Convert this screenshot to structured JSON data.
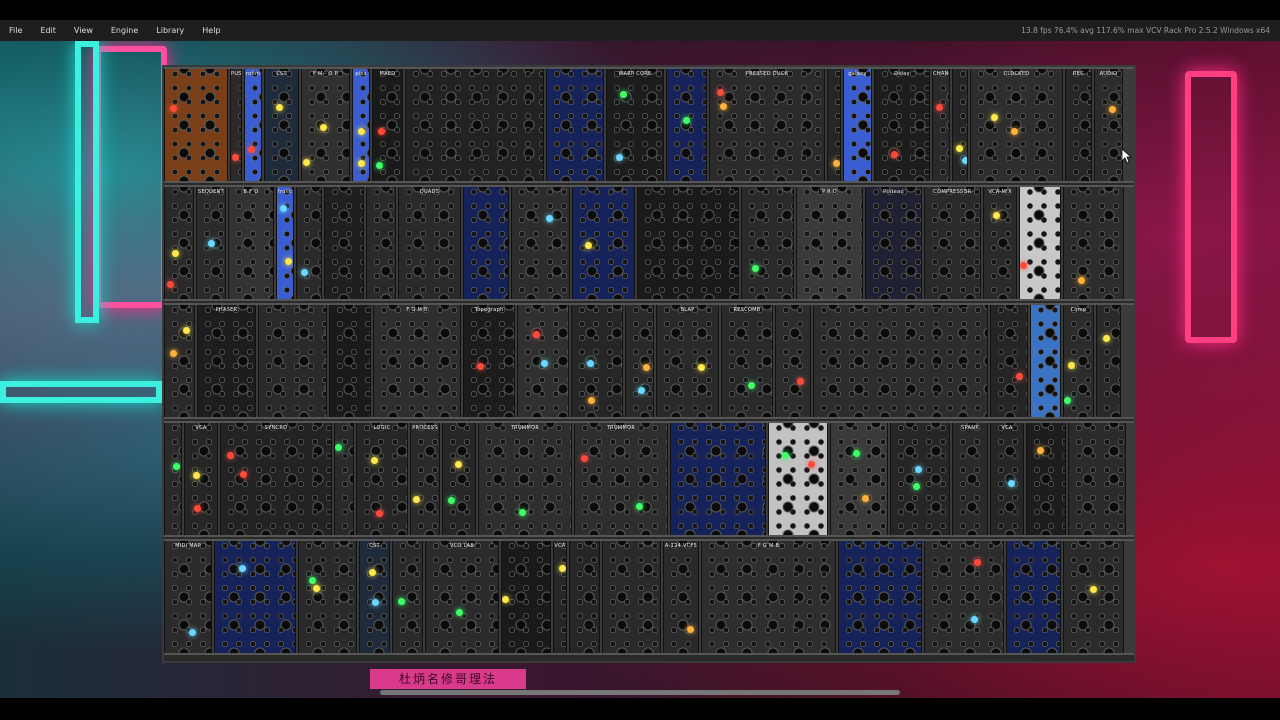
{
  "menu": {
    "items": [
      "File",
      "Edit",
      "View",
      "Engine",
      "Library",
      "Help"
    ]
  },
  "status": {
    "text": "13.8 fps  76.4% avg  117.6% max     VCV Rack Pro 2.5.2 Windows x64"
  },
  "wallpaper": {
    "sign_text": "杜炳名修哥理法",
    "colors": {
      "neon_pink": "#ff4f9e",
      "neon_cyan": "#3cf0e0"
    }
  },
  "rack": {
    "rows": [
      {
        "modules": [
          {
            "title": "",
            "color": "#7a3f16",
            "w": 62
          },
          {
            "title": "PUSH",
            "color": "#2a2a2a",
            "w": 12
          },
          {
            "title": "rohm",
            "color": "#3a5dd2",
            "w": 18
          },
          {
            "title": "CST",
            "color": "#1f2a3a",
            "w": 34
          },
          {
            "title": "F M - O P",
            "color": "#303030",
            "w": 48
          },
          {
            "title": "pixs",
            "color": "#3a5dd2",
            "w": 18
          },
          {
            "title": "MAED",
            "color": "#1a1a1a",
            "w": 30
          },
          {
            "title": "",
            "color": "#222",
            "w": 134
          },
          {
            "title": "",
            "color": "#15235a",
            "w": 56
          },
          {
            "title": "WARP CORE",
            "color": "#1c1c1c",
            "w": 56
          },
          {
            "title": "",
            "color": "#15235a",
            "w": 40
          },
          {
            "title": "PRESSED DUCK",
            "color": "#2b2b2b",
            "w": 112
          },
          {
            "title": "",
            "color": "#262626",
            "w": 14
          },
          {
            "title": "galaxy",
            "color": "#3a5dd2",
            "w": 28
          },
          {
            "title": "Delay",
            "color": "#1d1d1d",
            "w": 54
          },
          {
            "title": "CHANCE",
            "color": "#2a2a2a",
            "w": 18
          },
          {
            "title": "",
            "color": "#262626",
            "w": 16
          },
          {
            "title": "CLOCKED",
            "color": "#2e2e2e",
            "w": 90
          },
          {
            "title": "REC",
            "color": "#262626",
            "w": 26
          },
          {
            "title": "AUDIO",
            "color": "#2c2c2c",
            "w": 28
          }
        ]
      },
      {
        "modules": [
          {
            "title": "",
            "color": "#2a2a2a",
            "w": 30
          },
          {
            "title": "SEQUENT",
            "color": "#2b2b2b",
            "w": 30
          },
          {
            "title": "B F O",
            "color": "#333",
            "w": 46
          },
          {
            "title": "frolic",
            "color": "#3a5dd2",
            "w": 18
          },
          {
            "title": "",
            "color": "#2a2a2a",
            "w": 26
          },
          {
            "title": "",
            "color": "#1f1f1f",
            "w": 40
          },
          {
            "title": "",
            "color": "#2a2a2a",
            "w": 30
          },
          {
            "title": "QUADS",
            "color": "#2a2a2a",
            "w": 62
          },
          {
            "title": "",
            "color": "#15235a",
            "w": 46
          },
          {
            "title": "",
            "color": "#2d2d2d",
            "w": 58
          },
          {
            "title": "",
            "color": "#15235a",
            "w": 62
          },
          {
            "title": "",
            "color": "#1a1a1a",
            "w": 100
          },
          {
            "title": "",
            "color": "#2a2a2a",
            "w": 52
          },
          {
            "title": "P R O",
            "color": "#3a3a3a",
            "w": 66
          },
          {
            "title": "Plateau",
            "color": "#1f2133",
            "w": 56
          },
          {
            "title": "COMPRESSOR",
            "color": "#2a2a2a",
            "w": 56
          },
          {
            "title": "VCA-MIX",
            "color": "#2a2a2a",
            "w": 34
          },
          {
            "title": "",
            "color": "#c8c8c8",
            "w": 42
          },
          {
            "title": "",
            "color": "#2d2d2d",
            "w": 60
          }
        ]
      },
      {
        "modules": [
          {
            "title": "",
            "color": "#2a2a2a",
            "w": 30
          },
          {
            "title": "PHASER",
            "color": "#1d1d1d",
            "w": 56
          },
          {
            "title": "",
            "color": "#2a2a2a",
            "w": 66
          },
          {
            "title": "",
            "color": "#1a1a1a",
            "w": 40
          },
          {
            "title": "F G M B",
            "color": "#2e2e2e",
            "w": 84
          },
          {
            "title": "Topograph",
            "color": "#1c1c1c",
            "w": 50
          },
          {
            "title": "",
            "color": "#303030",
            "w": 50
          },
          {
            "title": "",
            "color": "#262626",
            "w": 50
          },
          {
            "title": "",
            "color": "#2a2a2a",
            "w": 28
          },
          {
            "title": "BLAP",
            "color": "#2a2a2a",
            "w": 60
          },
          {
            "title": "RESCOMB",
            "color": "#2a2a2a",
            "w": 50
          },
          {
            "title": "",
            "color": "#2d2d2d",
            "w": 34
          },
          {
            "title": "",
            "color": "#2d2d2d",
            "w": 166
          },
          {
            "title": "",
            "color": "#252525",
            "w": 36
          },
          {
            "title": "",
            "color": "#3a72c4",
            "w": 30
          },
          {
            "title": "Comp",
            "color": "#2c2c2c",
            "w": 30
          },
          {
            "title": "",
            "color": "#2a2a2a",
            "w": 24
          }
        ]
      },
      {
        "modules": [
          {
            "title": "",
            "color": "#2a2a2a",
            "w": 18
          },
          {
            "title": "VCA",
            "color": "#262626",
            "w": 34
          },
          {
            "title": "SYNCRO",
            "color": "#232323",
            "w": 112
          },
          {
            "title": "",
            "color": "#2a2a2a",
            "w": 20
          },
          {
            "title": "LOGIC",
            "color": "#262626",
            "w": 52
          },
          {
            "title": "PROCESS",
            "color": "#2a2a2a",
            "w": 30
          },
          {
            "title": "",
            "color": "#262626",
            "w": 34
          },
          {
            "title": "TRUMMOR",
            "color": "#2e2e2e",
            "w": 94
          },
          {
            "title": "TRUMMOR",
            "color": "#2e2e2e",
            "w": 94
          },
          {
            "title": "",
            "color": "#15235a",
            "w": 96
          },
          {
            "title": "",
            "color": "#c2c2c2",
            "w": 60
          },
          {
            "title": "",
            "color": "#3a3a3a",
            "w": 58
          },
          {
            "title": "",
            "color": "#262626",
            "w": 60
          },
          {
            "title": "SPANK",
            "color": "#2a2a2a",
            "w": 36
          },
          {
            "title": "VCA",
            "color": "#262626",
            "w": 34
          },
          {
            "title": "",
            "color": "#1d1d1d",
            "w": 40
          },
          {
            "title": "",
            "color": "#2b2b2b",
            "w": 58
          }
        ]
      },
      {
        "modules": [
          {
            "title": "MIDI MAP",
            "color": "#2b2b2b",
            "w": 46
          },
          {
            "title": "",
            "color": "#15235a",
            "w": 78
          },
          {
            "title": "",
            "color": "#2a2a2a",
            "w": 56
          },
          {
            "title": "CST",
            "color": "#1f2a3a",
            "w": 30
          },
          {
            "title": "",
            "color": "#2a2a2a",
            "w": 30
          },
          {
            "title": "VCO LAB",
            "color": "#2b2b2b",
            "w": 70
          },
          {
            "title": "",
            "color": "#1a1a1a",
            "w": 48
          },
          {
            "title": "VCA",
            "color": "#262626",
            "w": 14
          },
          {
            "title": "",
            "color": "#262626",
            "w": 30
          },
          {
            "title": "",
            "color": "#2a2a2a",
            "w": 56
          },
          {
            "title": "A-124 VCF5",
            "color": "#2a2a2a",
            "w": 34
          },
          {
            "title": "F G M B",
            "color": "#2e2e2e",
            "w": 128
          },
          {
            "title": "",
            "color": "#15235a",
            "w": 80
          },
          {
            "title": "",
            "color": "#2d2d2d",
            "w": 76
          },
          {
            "title": "",
            "color": "#15235a",
            "w": 52
          },
          {
            "title": "",
            "color": "#2b2b2b",
            "w": 58
          }
        ]
      }
    ]
  }
}
